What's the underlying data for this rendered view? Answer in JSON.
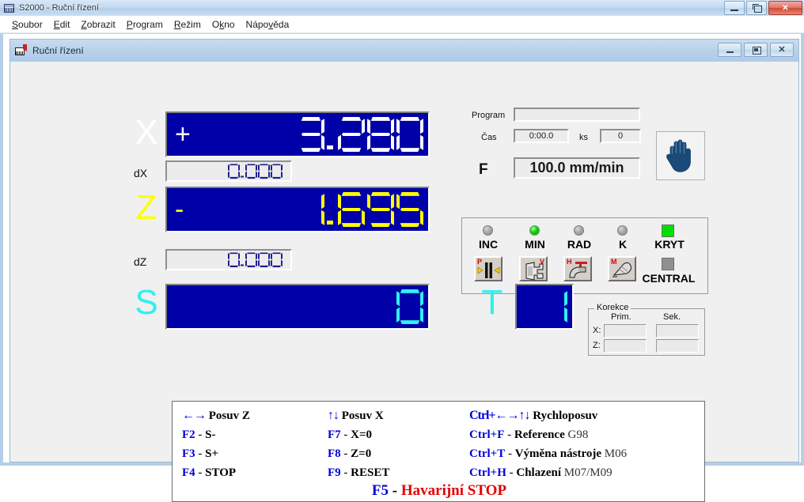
{
  "window": {
    "title": "S2000 - Ruční řízení",
    "icon": "app-icon",
    "buttons": {
      "minimize": "−",
      "restore": "❐",
      "close": "✕"
    }
  },
  "menu": {
    "items": [
      {
        "pre": "",
        "accel": "S",
        "post": "oubor"
      },
      {
        "pre": "",
        "accel": "E",
        "post": "dit"
      },
      {
        "pre": "",
        "accel": "Z",
        "post": "obrazit"
      },
      {
        "pre": "",
        "accel": "P",
        "post": "rogram"
      },
      {
        "pre": "",
        "accel": "R",
        "post": "ežim"
      },
      {
        "pre": "O",
        "accel": "k",
        "post": "no"
      },
      {
        "pre": "Nápo",
        "accel": "v",
        "post": "ěda"
      }
    ]
  },
  "child_window": {
    "title": "Ruční řízení",
    "buttons": {
      "minimize": "−",
      "restore": "❐",
      "close": "✕"
    }
  },
  "dro": {
    "x": {
      "label": "X",
      "color": "#ffffff",
      "sign": "+",
      "value": "3.280"
    },
    "dx": {
      "label": "dX",
      "value": "0.000"
    },
    "z": {
      "label": "Z",
      "color": "#ffff00",
      "sign": "-",
      "value": "1.695"
    },
    "dz": {
      "label": "dZ",
      "value": "0.000"
    },
    "s": {
      "label": "S",
      "color": "#2ff0f0",
      "value": "0"
    },
    "t": {
      "label": "T",
      "color": "#2ff0f0",
      "value": "1"
    }
  },
  "status": {
    "program_label": "Program",
    "program_value": "",
    "time_label": "Čas",
    "time_value": "0:00.0",
    "pieces_label": "ks",
    "pieces_value": "0",
    "feed_label": "F",
    "feed_value": "100.0 mm/min",
    "mode_icon": "hand-icon"
  },
  "mode_panel": {
    "leds": [
      {
        "name": "INC",
        "state": "off"
      },
      {
        "name": "MIN",
        "state": "on"
      },
      {
        "name": "RAD",
        "state": "off"
      },
      {
        "name": "K",
        "state": "off"
      }
    ],
    "kryt_label": "KRYT",
    "kryt_state": "on",
    "central_label": "CENTRAL",
    "central_state": "off",
    "tool_buttons": [
      {
        "badge": "P",
        "icon": "spindle-brake-icon"
      },
      {
        "badge": "V",
        "icon": "chip-conveyor-icon"
      },
      {
        "badge": "H",
        "icon": "coolant-hose-icon"
      },
      {
        "badge": "M",
        "icon": "mist-coolant-icon"
      }
    ]
  },
  "korekce": {
    "legend": "Korekce",
    "col_primary": "Prim.",
    "col_secondary": "Sek.",
    "rows": [
      {
        "axis": "X:",
        "primary": "",
        "secondary": ""
      },
      {
        "axis": "Z:",
        "primary": "",
        "secondary": ""
      }
    ]
  },
  "legend": {
    "col1": [
      {
        "key": "←→",
        "sep": "",
        "action": "Posuv Z",
        "note": "",
        "keyarrow": true
      },
      {
        "key": "F2",
        "sep": " - ",
        "action": "S-",
        "note": ""
      },
      {
        "key": "F3",
        "sep": " - ",
        "action": "S+",
        "note": ""
      },
      {
        "key": "F4",
        "sep": " - ",
        "action": "STOP",
        "note": ""
      }
    ],
    "col2": [
      {
        "key": "↑↓",
        "sep": "",
        "action": "Posuv X",
        "note": "",
        "keyarrow": true
      },
      {
        "key": "F7",
        "sep": " - ",
        "action": "X=0",
        "note": ""
      },
      {
        "key": "F8",
        "sep": " - ",
        "action": "Z=0",
        "note": ""
      },
      {
        "key": "F9",
        "sep": " - ",
        "action": "RESET",
        "note": ""
      }
    ],
    "col3": [
      {
        "key": "Ctrl+←→↑↓",
        "sep": " ",
        "action": "Rychloposuv",
        "note": "",
        "keyarrow": true
      },
      {
        "key": "Ctrl+F",
        "sep": " - ",
        "action": "Reference",
        "note": "G98"
      },
      {
        "key": "Ctrl+T",
        "sep": " - ",
        "action": "Výměna nástroje",
        "note": "M06"
      },
      {
        "key": "Ctrl+H",
        "sep": " - ",
        "action": "Chlazení",
        "note": "M07/M09"
      }
    ],
    "emergency_key": "F5",
    "emergency_sep": " - ",
    "emergency_action": "Havarijní STOP"
  },
  "colors": {
    "dro_bg": "#0000a8",
    "x_digit": "#ffffff",
    "z_digit": "#ffff00",
    "s_digit": "#2ff0f0",
    "small_digit": "#1a1a8c",
    "accent_blue": "#0000d8",
    "danger_red": "#e00000",
    "led_on": "#13d613"
  }
}
